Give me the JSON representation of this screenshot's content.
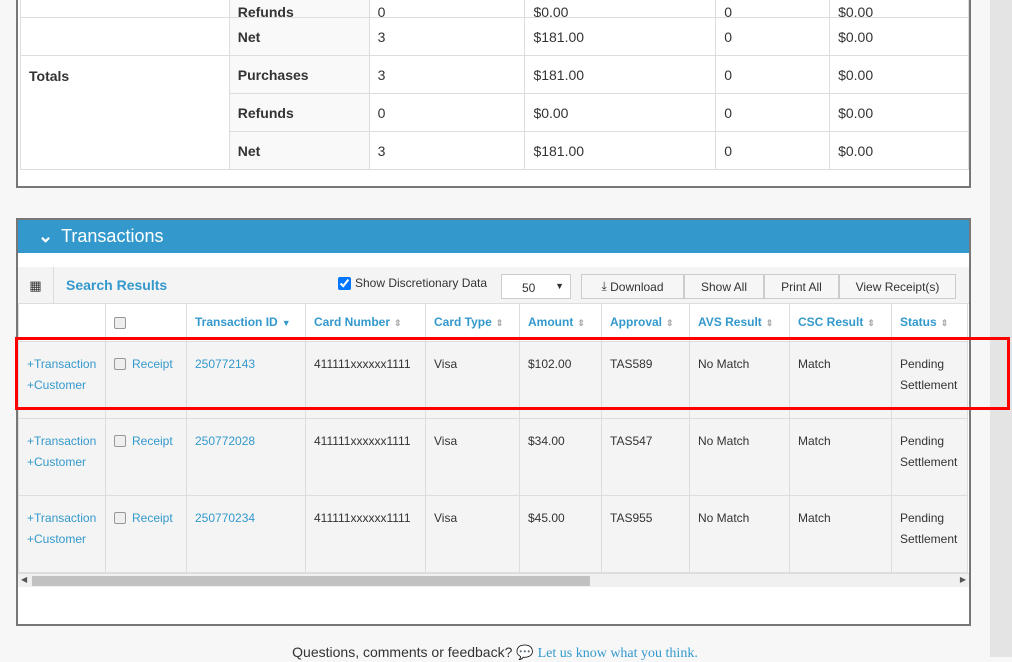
{
  "summary": {
    "rows": [
      {
        "group": "",
        "type": "Refunds",
        "count": "0",
        "amount": "$0.00",
        "count2": "0",
        "amount2": "$0.00"
      },
      {
        "group": "",
        "type": "Net",
        "count": "3",
        "amount": "$181.00",
        "count2": "0",
        "amount2": "$0.00"
      },
      {
        "group": "Totals",
        "type": "Purchases",
        "count": "3",
        "amount": "$181.00",
        "count2": "0",
        "amount2": "$0.00"
      },
      {
        "group": "",
        "type": "Refunds",
        "count": "0",
        "amount": "$0.00",
        "count2": "0",
        "amount2": "$0.00"
      },
      {
        "group": "",
        "type": "Net",
        "count": "3",
        "amount": "$181.00",
        "count2": "0",
        "amount2": "$0.00"
      }
    ]
  },
  "transactions": {
    "title": "Transactions",
    "search_results": "Search Results",
    "show_discretionary": "Show Discretionary Data",
    "page_size": "50",
    "buttons": {
      "download": "Download",
      "show_all": "Show All",
      "print_all": "Print All",
      "view_receipts": "View Receipt(s)"
    },
    "columns": [
      "Transaction ID",
      "Card Number",
      "Card Type",
      "Amount",
      "Approval",
      "AVS Result",
      "CSC Result",
      "Status"
    ],
    "add_transaction": "+Transaction",
    "add_customer": "+Customer",
    "receipt": "Receipt",
    "rows": [
      {
        "id": "250772143",
        "card": "411111xxxxxx1111",
        "type": "Visa",
        "amount": "$102.00",
        "approval": "TAS589",
        "avs": "No Match",
        "csc": "Match",
        "status": "Pending Settlement"
      },
      {
        "id": "250772028",
        "card": "411111xxxxxx1111",
        "type": "Visa",
        "amount": "$34.00",
        "approval": "TAS547",
        "avs": "No Match",
        "csc": "Match",
        "status": "Pending Settlement"
      },
      {
        "id": "250770234",
        "card": "411111xxxxxx1111",
        "type": "Visa",
        "amount": "$45.00",
        "approval": "TAS955",
        "avs": "No Match",
        "csc": "Match",
        "status": "Pending Settlement"
      }
    ]
  },
  "footer": {
    "text": "Questions, comments or feedback?",
    "link": "Let us know what you think."
  },
  "colors": {
    "accent": "#3399cc",
    "highlight": "#ff0000"
  }
}
